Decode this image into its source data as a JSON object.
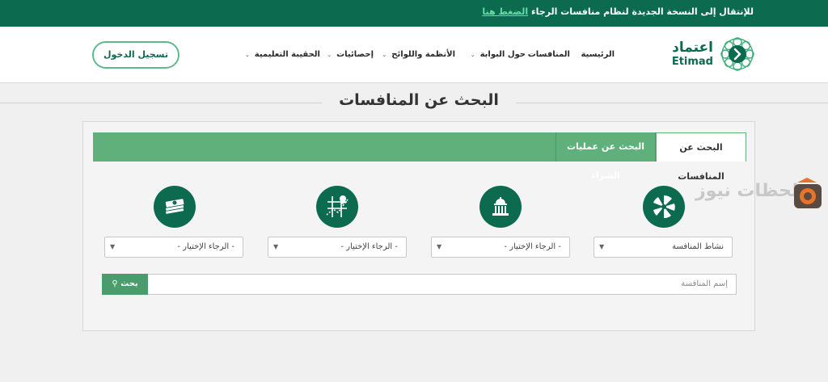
{
  "notice": {
    "text": "للإنتقال إلى النسخة الجديدة لنظام منافسات الرجاء",
    "link": "الضغط هنا"
  },
  "logo": {
    "arabic": "اعتماد",
    "english": "Etimad"
  },
  "nav": {
    "home": "الرئيسية",
    "competitions": "المنافسات",
    "about": "حول البوابة",
    "regulations": "الأنظمة واللوائح",
    "statistics": "إحصائيات",
    "training": "الحقيبة التعليمية"
  },
  "login": "تسجيل الدخول",
  "page_title": "البحث عن المنافسات",
  "tabs": {
    "competitions": "البحث عن المنافسات",
    "purchases": "البحث عن عمليات الشراء"
  },
  "filters": [
    {
      "value": "نشاط المنافسة",
      "icon": "activity-wheel-icon"
    },
    {
      "value": "- الرجاء الإختيار -",
      "icon": "government-building-icon"
    },
    {
      "value": "- الرجاء الإختيار -",
      "icon": "map-location-icon"
    },
    {
      "value": "- الرجاء الإختيار -",
      "icon": "money-stack-icon"
    }
  ],
  "search": {
    "placeholder": "إسم المنافسة",
    "button": "بحث"
  },
  "watermark": "لحظات نيوز",
  "colors": {
    "brand_dark": "#0c6b4e",
    "brand_light": "#5fb07a",
    "link_green": "#5ee0a4"
  }
}
